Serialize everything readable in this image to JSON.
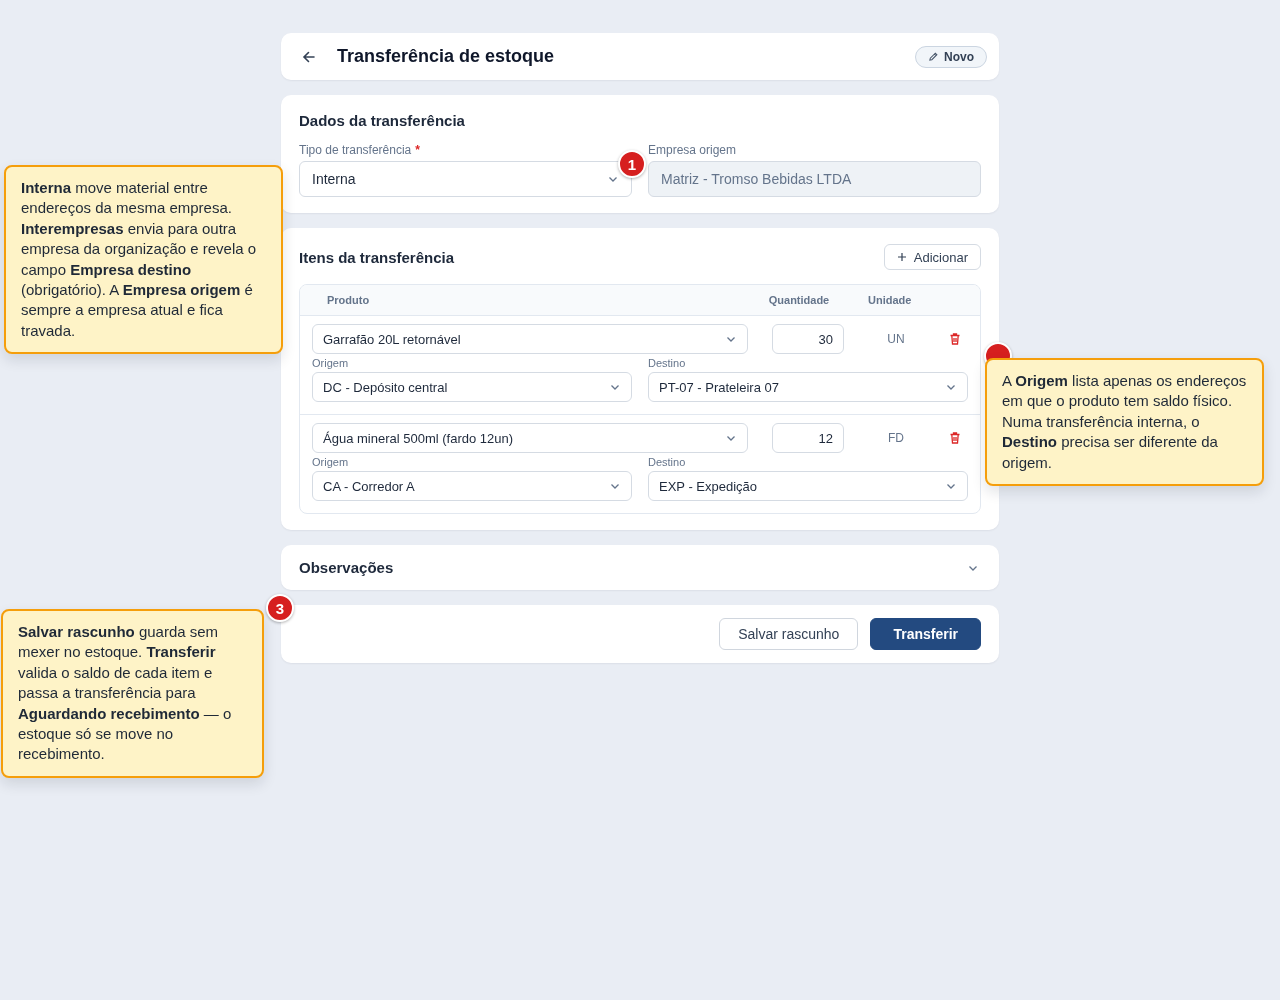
{
  "header": {
    "title": "Transferência de estoque",
    "badge": "Novo"
  },
  "dados": {
    "title": "Dados da transferência",
    "fields": [
      {
        "label": "Tipo de transferência",
        "required_mark": "*",
        "value": "Interna",
        "kind": "select",
        "disabled": false
      },
      {
        "label": "Empresa origem",
        "value": "Matriz - Tromso Bebidas LTDA",
        "kind": "text",
        "disabled": true
      }
    ]
  },
  "itens": {
    "title": "Itens da transferência",
    "add_button": "Adicionar",
    "columns": [
      "Produto",
      "Quantidade",
      "Unidade"
    ],
    "rows": [
      {
        "produto": "Garrafão 20L retornável",
        "quantidade": "30",
        "unidade": "UN",
        "origem_label": "Origem",
        "origem": "DC - Depósito central",
        "destino_label": "Destino",
        "destino": "PT-07 - Prateleira 07"
      },
      {
        "produto": "Água mineral 500ml (fardo 12un)",
        "quantidade": "12",
        "unidade": "FD",
        "origem_label": "Origem",
        "origem": "CA - Corredor A",
        "destino_label": "Destino",
        "destino": "EXP - Expedição"
      }
    ]
  },
  "observacoes": {
    "title": "Observações",
    "expanded": false
  },
  "actions": [
    {
      "label": "Salvar rascunho",
      "kind": "secondary"
    },
    {
      "label": "Transferir",
      "kind": "primary"
    }
  ],
  "callouts": [
    {
      "number": "1",
      "text": "**Interna** move material entre endereços da mesma empresa. **Interempresas** envia para outra empresa da organização e revela o campo **Empresa destino** (obrigatório). A **Empresa origem** é sempre a empresa atual e fica travada."
    },
    {
      "text": "A **Origem** lista apenas os endereços em que o produto tem saldo físico. Numa transferência interna, o **Destino** precisa ser diferente da origem."
    },
    {
      "number": "3",
      "text": "**Salvar rascunho** guarda sem mexer no estoque. **Transferir** valida o saldo de cada item e passa a transferência para **Aguardando recebimento** — o estoque só se move no recebimento."
    }
  ]
}
